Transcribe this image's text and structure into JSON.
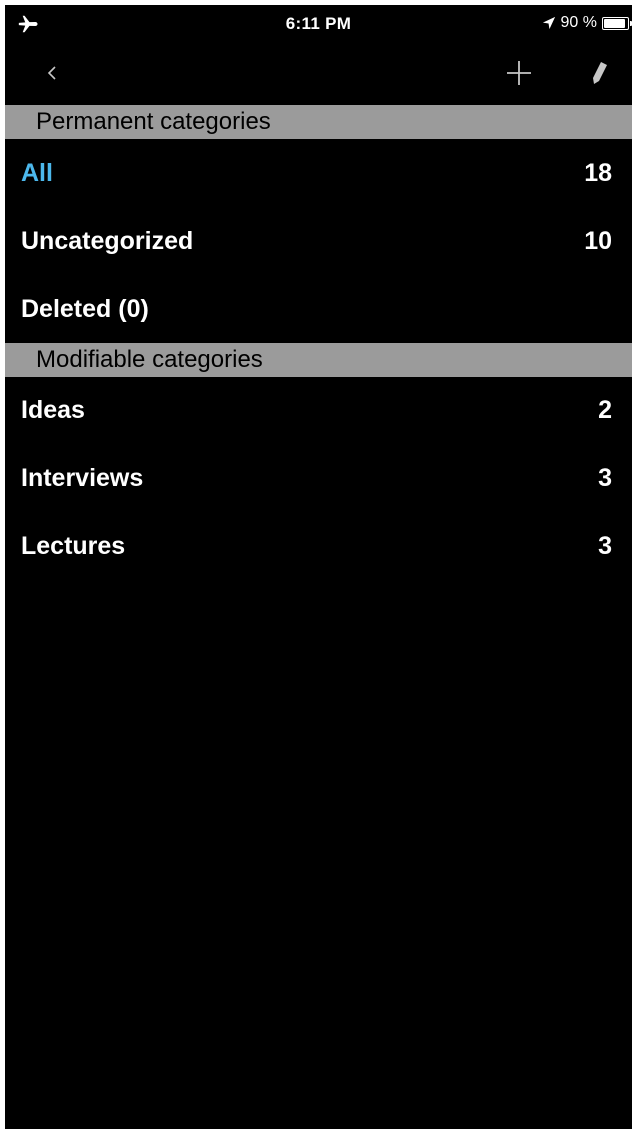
{
  "status_bar": {
    "airplane_icon": "airplane-icon",
    "time": "6:11 PM",
    "location_icon": "location-arrow-icon",
    "battery_percent": "90 %",
    "battery_level": 0.9,
    "battery_icon": "battery-icon"
  },
  "nav_bar": {
    "back_icon": "chevron-left-icon",
    "add_icon": "plus-icon",
    "edit_icon": "pencil-icon"
  },
  "permanent": {
    "header": "Permanent categories",
    "items": [
      {
        "label": "All",
        "count": "18",
        "selected": true
      },
      {
        "label": "Uncategorized",
        "count": "10"
      },
      {
        "label": "Deleted (0)",
        "count": ""
      }
    ]
  },
  "modifiable": {
    "header": "Modifiable categories",
    "items": [
      {
        "label": "Ideas",
        "count": "2"
      },
      {
        "label": "Interviews",
        "count": "3"
      },
      {
        "label": "Lectures",
        "count": "3"
      }
    ]
  },
  "colors": {
    "background": "#000000",
    "section_header_bg": "#9b9b9b",
    "selected_text": "#4cb8ec",
    "text": "#ffffff"
  }
}
